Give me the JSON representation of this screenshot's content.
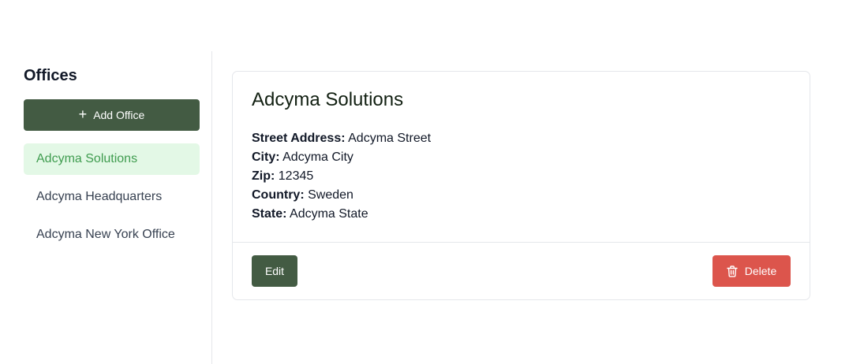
{
  "sidebar": {
    "title": "Offices",
    "add_button": {
      "icon": "plus-icon",
      "label": "Add Office"
    },
    "offices": [
      {
        "label": "Adcyma Solutions",
        "selected": true
      },
      {
        "label": "Adcyma Headquarters",
        "selected": false
      },
      {
        "label": "Adcyma New York Office",
        "selected": false
      }
    ]
  },
  "detail": {
    "title": "Adcyma Solutions",
    "fields": [
      {
        "label": "Street Address:",
        "value": "Adcyma Street"
      },
      {
        "label": "City:",
        "value": "Adcyma City"
      },
      {
        "label": "Zip:",
        "value": "12345"
      },
      {
        "label": "Country:",
        "value": "Sweden"
      },
      {
        "label": "State:",
        "value": "Adcyma State"
      }
    ],
    "edit_label": "Edit",
    "delete_label": "Delete",
    "delete_icon": "trash-icon"
  },
  "colors": {
    "primary": "#435b43",
    "active_bg": "#e3f8e6",
    "active_text": "#3f9c4f",
    "danger": "#dc554c"
  }
}
